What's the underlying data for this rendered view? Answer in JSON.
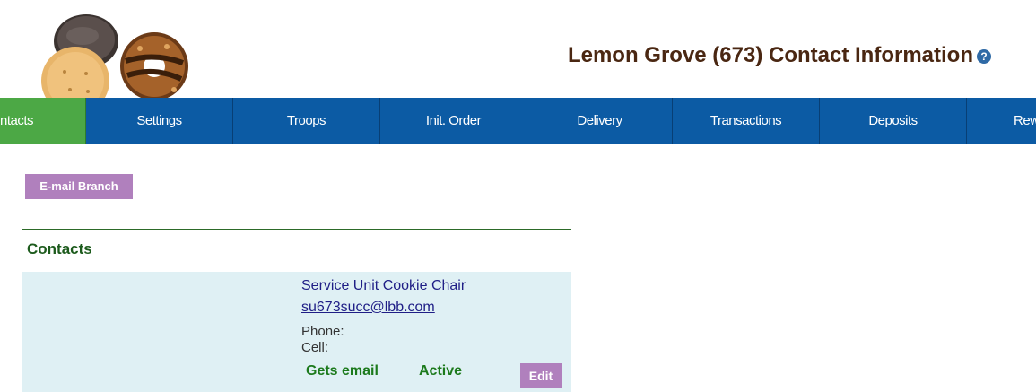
{
  "header": {
    "title": "Lemon Grove (673) Contact Information",
    "help_icon": "help-icon"
  },
  "nav": {
    "items": [
      {
        "label": "ntacts",
        "active": true
      },
      {
        "label": "Settings",
        "active": false
      },
      {
        "label": "Troops",
        "active": false
      },
      {
        "label": "Init. Order",
        "active": false
      },
      {
        "label": "Delivery",
        "active": false
      },
      {
        "label": "Transactions",
        "active": false
      },
      {
        "label": "Deposits",
        "active": false
      },
      {
        "label": "Rew",
        "active": false
      }
    ]
  },
  "actions": {
    "email_branch_label": "E-mail Branch"
  },
  "contacts": {
    "section_title": "Contacts",
    "items": [
      {
        "role": "Service Unit Cookie Chair",
        "email": "su673succ@lbb.com",
        "phone_label": "Phone:",
        "cell_label": "Cell:",
        "gets_email_label": "Gets email",
        "status_label": "Active",
        "edit_label": "Edit"
      }
    ]
  },
  "colors": {
    "nav_bg": "#0c5ba4",
    "nav_active": "#4ca845",
    "button_purple": "#b080bd",
    "title_brown": "#4a2712",
    "section_green": "#1d5b1d",
    "card_bg": "#dff0f4"
  }
}
